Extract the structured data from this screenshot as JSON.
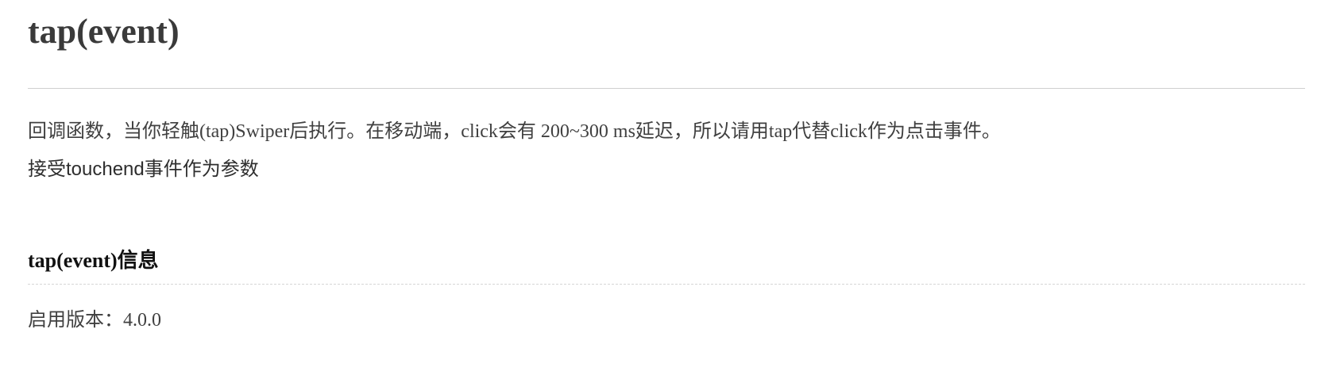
{
  "heading": {
    "title": "tap(event)"
  },
  "content": {
    "description": "回调函数，当你轻触(tap)Swiper后执行。在移动端，click会有 200~300 ms延迟，所以请用tap代替click作为点击事件。",
    "parameter": "接受touchend事件作为参数"
  },
  "info": {
    "heading": "tap(event)信息",
    "version_label": "启用版本：",
    "version_value": "4.0.0"
  }
}
